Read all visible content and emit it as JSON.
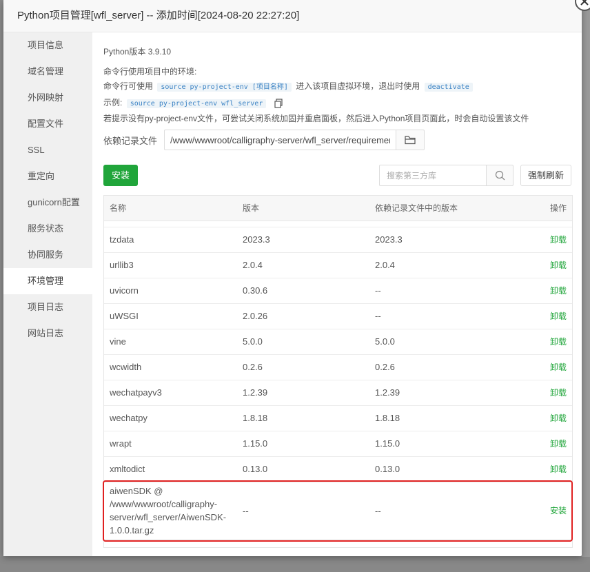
{
  "dialog": {
    "title": "Python项目管理[wfl_server] -- 添加时间[2024-08-20 22:27:20]"
  },
  "sidebar": {
    "items": [
      {
        "label": "项目信息"
      },
      {
        "label": "域名管理"
      },
      {
        "label": "外网映射"
      },
      {
        "label": "配置文件"
      },
      {
        "label": "SSL"
      },
      {
        "label": "重定向"
      },
      {
        "label": "gunicorn配置"
      },
      {
        "label": "服务状态"
      },
      {
        "label": "协同服务"
      },
      {
        "label": "环境管理",
        "active": true
      },
      {
        "label": "项目日志"
      },
      {
        "label": "网站日志"
      }
    ]
  },
  "info": {
    "python_version": "Python版本 3.9.10",
    "env_intro": "命令行使用项目中的环境:",
    "cmd_prefix": "命令行可使用",
    "cmd_code": "source py-project-env [项目名称]",
    "cmd_middle": "进入该项目虚拟环境，退出时使用",
    "cmd_deactivate": "deactivate",
    "example_label": "示例:",
    "example_code": "source py-project-env wfl_server",
    "tip": "若提示没有py-project-env文件，可尝试关闭系统加固并重启面板，然后进入Python项目页面此，时会自动设置该文件"
  },
  "dependency": {
    "label": "依赖记录文件",
    "value": "/www/wwwroot/calligraphy-server/wfl_server/requirements.txt"
  },
  "toolbar": {
    "install_label": "安装",
    "search_placeholder": "搜索第三方库",
    "refresh_label": "强制刷新"
  },
  "table": {
    "headers": [
      "名称",
      "版本",
      "依赖记录文件中的版本",
      "操作"
    ],
    "rows": [
      {
        "name": "tzdata",
        "version": "2023.3",
        "req_version": "2023.3",
        "action": "卸载"
      },
      {
        "name": "urllib3",
        "version": "2.0.4",
        "req_version": "2.0.4",
        "action": "卸载"
      },
      {
        "name": "uvicorn",
        "version": "0.30.6",
        "req_version": "--",
        "action": "卸载"
      },
      {
        "name": "uWSGI",
        "version": "2.0.26",
        "req_version": "--",
        "action": "卸载"
      },
      {
        "name": "vine",
        "version": "5.0.0",
        "req_version": "5.0.0",
        "action": "卸载"
      },
      {
        "name": "wcwidth",
        "version": "0.2.6",
        "req_version": "0.2.6",
        "action": "卸载"
      },
      {
        "name": "wechatpayv3",
        "version": "1.2.39",
        "req_version": "1.2.39",
        "action": "卸载"
      },
      {
        "name": "wechatpy",
        "version": "1.8.18",
        "req_version": "1.8.18",
        "action": "卸载"
      },
      {
        "name": "wrapt",
        "version": "1.15.0",
        "req_version": "1.15.0",
        "action": "卸载"
      },
      {
        "name": "xmltodict",
        "version": "0.13.0",
        "req_version": "0.13.0",
        "action": "卸载"
      },
      {
        "name": "aiwenSDK @ /www/wwwroot/calligraphy-server/wfl_server/AiwenSDK-1.0.0.tar.gz",
        "version": "--",
        "req_version": "--",
        "action": "安装"
      }
    ]
  },
  "colors": {
    "accent_green": "#20a53a",
    "highlight_red": "#e02020"
  }
}
